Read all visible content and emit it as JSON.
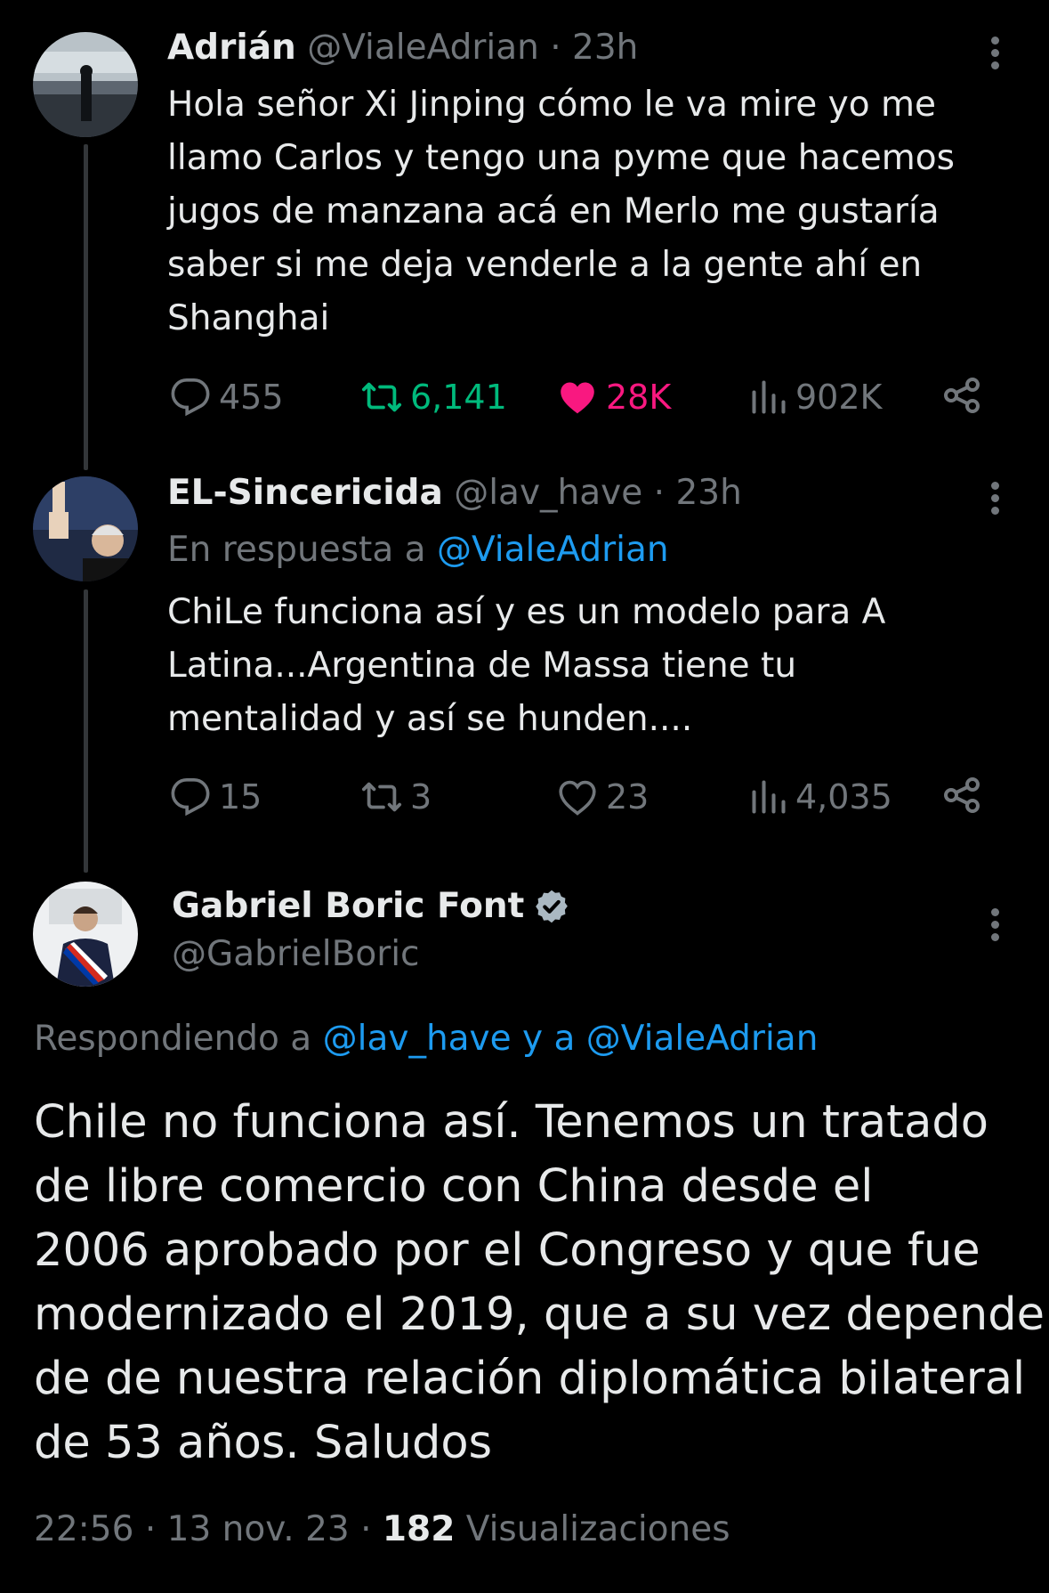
{
  "colors": {
    "background": "#000000",
    "text": "#e7e9ea",
    "muted": "#71767b",
    "link": "#1d9bf0",
    "retweet": "#00ba7c",
    "like": "#f91880",
    "thread_line": "#333639"
  },
  "tweets": [
    {
      "name": "Adrián",
      "handle": "@VialeAdrian",
      "separator": "·",
      "time": "23h",
      "text_lines": [
        "Hola señor Xi Jinping cómo le va mire yo me",
        "llamo Carlos y tengo una pyme que hacemos",
        "jugos de manzana acá en Merlo me gustaría",
        "saber si me deja venderle a la gente ahí en",
        "Shanghai"
      ],
      "replies": "455",
      "retweets": "6,141",
      "likes": "28K",
      "views": "902K",
      "retweeted": true,
      "liked": true,
      "more_icon": "more-vertical-icon"
    },
    {
      "name": "EL-Sincericida",
      "handle": "@lav_have",
      "separator": "·",
      "time": "23h",
      "reply_prefix": "En respuesta a",
      "reply_to": "@VialeAdrian",
      "text_lines": [
        "ChiLe funciona así y es un modelo para A",
        "Latina...Argentina de Massa tiene tu",
        "mentalidad y así se hunden...."
      ],
      "replies": "15",
      "retweets": "3",
      "likes": "23",
      "views": "4,035",
      "retweeted": false,
      "liked": false,
      "more_icon": "more-vertical-icon"
    }
  ],
  "main_tweet": {
    "name": "Gabriel Boric Font",
    "verified_icon": "verified-badge-icon",
    "handle": "@GabrielBoric",
    "replying_prefix": "Respondiendo a",
    "replying_to": "@lav_have y a @VialeAdrian",
    "text_lines": [
      "Chile no funciona así. Tenemos un tratado",
      "de libre comercio con China desde el",
      "2006 aprobado por el Congreso y que fue",
      "modernizado el 2019, que a su vez depende",
      "de de nuestra relación diplomática bilateral",
      "de 53 años. Saludos"
    ],
    "time": "22:56",
    "separator": "·",
    "date": "13 nov. 23",
    "views_count": "182",
    "views_label": "Visualizaciones"
  }
}
